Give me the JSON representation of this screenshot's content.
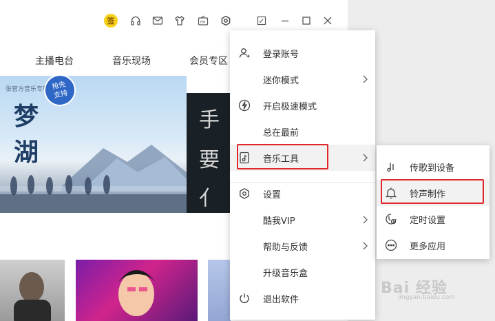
{
  "titlebar": {
    "sign_label": "签",
    "icons": [
      "headphones-icon",
      "mail-icon",
      "shirt-icon",
      "fm-icon",
      "gear-icon",
      "mini-window-icon",
      "minimize-icon",
      "maximize-icon",
      "close-icon"
    ],
    "fm_label": "FM"
  },
  "nav": {
    "tabs": [
      {
        "label": "主播电台"
      },
      {
        "label": "音乐现场"
      },
      {
        "label": "会员专区"
      }
    ]
  },
  "banner": {
    "album_tag": "张官方音乐专辑",
    "title_chars": [
      "梦",
      "湖"
    ],
    "badge": "抢先\n支持",
    "side_chars": [
      "手",
      "要",
      "亻"
    ]
  },
  "menu": {
    "items": [
      {
        "label": "登录账号",
        "icon": "user-icon",
        "submenu": false
      },
      {
        "label": "迷你模式",
        "icon": "",
        "submenu": true
      },
      {
        "label": "开启极速模式",
        "icon": "lightning-icon",
        "submenu": false
      },
      {
        "label": "总在最前",
        "icon": "",
        "submenu": false
      },
      {
        "label": "音乐工具",
        "icon": "music-doc-icon",
        "submenu": true,
        "highlighted": true
      },
      {
        "label": "设置",
        "icon": "settings-hex-icon",
        "submenu": false
      },
      {
        "label": "酷我VIP",
        "icon": "",
        "submenu": true
      },
      {
        "label": "帮助与反馈",
        "icon": "",
        "submenu": true
      },
      {
        "label": "升级音乐盒",
        "icon": "",
        "submenu": false
      },
      {
        "label": "退出软件",
        "icon": "power-icon",
        "submenu": false
      }
    ]
  },
  "submenu": {
    "items": [
      {
        "label": "传歌到设备",
        "icon": "music-note-icon"
      },
      {
        "label": "铃声制作",
        "icon": "bell-icon",
        "highlighted": true
      },
      {
        "label": "定时设置",
        "icon": "timer-icon"
      },
      {
        "label": "更多应用",
        "icon": "more-icon"
      }
    ]
  },
  "watermark": {
    "main": "Bai 经验",
    "sub": "jingyan.baidu.com"
  },
  "colors": {
    "accent_red": "#e0262a",
    "sign_yellow": "#f7d21c",
    "menu_highlight": "#f2f2f2"
  }
}
